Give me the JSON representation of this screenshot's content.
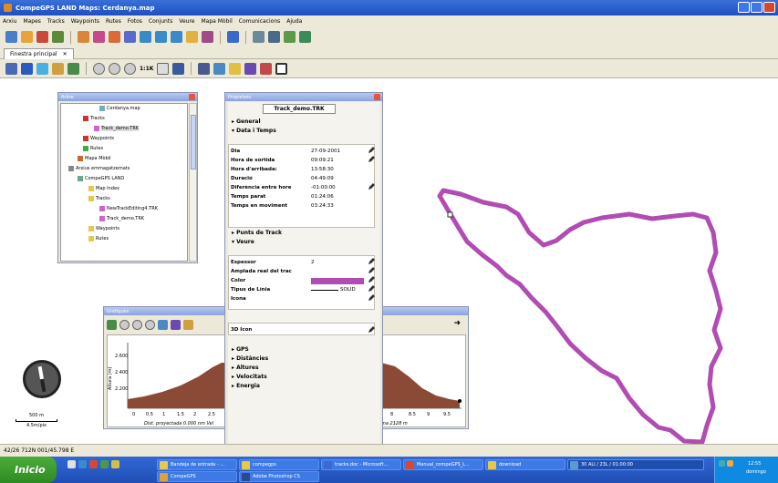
{
  "window": {
    "title": "CompeGPS LAND Maps: Cerdanya.map"
  },
  "menu": [
    "Arxiu",
    "Mapes",
    "Tracks",
    "Waypoints",
    "Rutes",
    "Fotos",
    "Conjunts",
    "Veure",
    "Mapa Mòbil",
    "Comunicacions",
    "Ajuda"
  ],
  "tab": {
    "label": "Finestra principal"
  },
  "toolbar2": {
    "zoom_label": "1:1K"
  },
  "layers": {
    "title": "Arbre",
    "items": [
      {
        "label": "Cerdanya.map"
      },
      {
        "label": "Tracks"
      },
      {
        "label": "Track_demo.TRK"
      },
      {
        "label": "Waypoints"
      },
      {
        "label": "Rutes"
      },
      {
        "label": "Mapa Mòbil"
      },
      {
        "label": "Arxius emmagatzemats"
      },
      {
        "label": "CompeGPS LAND"
      },
      {
        "label": "Map Index"
      },
      {
        "label": "Tracks"
      },
      {
        "label": "NewTrackEditing4.TRK"
      },
      {
        "label": "Track_demo.TRK"
      },
      {
        "label": "Waypoints"
      },
      {
        "label": "Rutes"
      }
    ]
  },
  "props": {
    "title": "Propietats",
    "track_name": "Track_demo.TRK",
    "sec_general": "General",
    "sec_data": "Data i Temps",
    "rows_time": [
      {
        "label": "Dia",
        "value": "27-09-2001"
      },
      {
        "label": "Hora de sortida",
        "value": "09:09:21"
      },
      {
        "label": "Hora d'arribada:",
        "value": "13:58:30"
      },
      {
        "label": "Duració",
        "value": "04:49:09"
      },
      {
        "label": "Diferència entre hore",
        "value": "-01:00:00"
      },
      {
        "label": "Temps parat",
        "value": "01:24:06"
      },
      {
        "label": "Temps en moviment",
        "value": "03:24:33"
      }
    ],
    "sec_punts": "Punts de Track",
    "sec_veure": "Veure",
    "rows_view": [
      {
        "label": "Espessor",
        "value": "2"
      },
      {
        "label": "Amplada real del trac",
        "value": ""
      },
      {
        "label": "Color",
        "value": ""
      },
      {
        "label": "Tipus de Línia",
        "value": "SOLID"
      },
      {
        "label": "Icona",
        "value": ""
      }
    ],
    "row_3d": "3D Icon",
    "track_color": "#b04cb4",
    "sections_bottom": [
      "GPS",
      "Distàncies",
      "Altures",
      "Velocitats",
      "Energia"
    ]
  },
  "graph": {
    "title": "Gràfiques",
    "ylabel": "Altura (m)",
    "yticks": [
      "2.600",
      "2.400",
      "2.200"
    ],
    "xticks_left": [
      "0",
      "0.5",
      "1",
      "1.5",
      "2",
      "2.5"
    ],
    "xticks_right": [
      "8",
      "8.5",
      "9",
      "9.5"
    ],
    "caption_left": "Dist. proyectada 0.000 nm  Vel",
    "caption_right": "ma 2128 m"
  },
  "scale": {
    "label": "500 m",
    "sublabel": "4.5m/pix"
  },
  "status": {
    "coords": "42/26 712N 001/45.798 E"
  },
  "taskbar": {
    "start_label": "Inicio",
    "tasks": [
      "Bandeja de entrada - ...",
      "compegps",
      "tracks.doc - Microsoft...",
      "Manual_compeGPS_L...",
      "download",
      "CompeGPS",
      "Adobe Photoshop CS"
    ],
    "tray_time": "12:55",
    "tray_day": "domingo",
    "tray_task": "30 ALI / 23L / 01:00:00"
  }
}
